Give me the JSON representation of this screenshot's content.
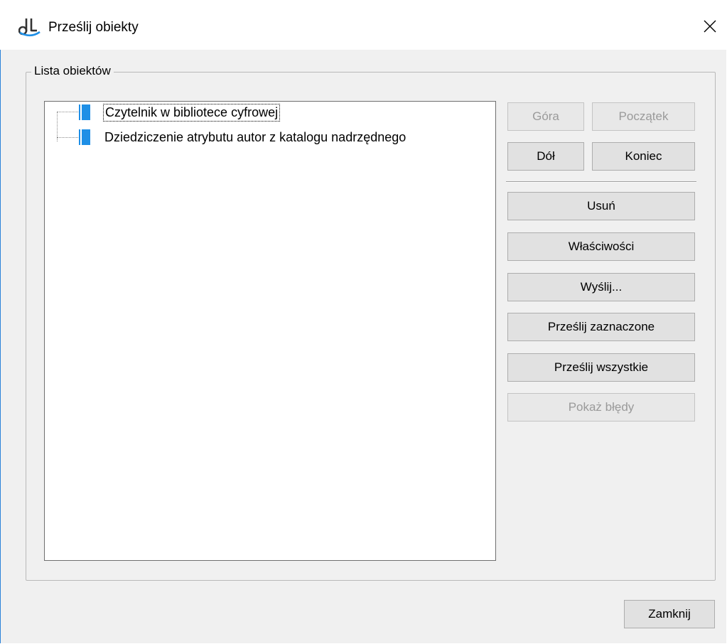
{
  "window": {
    "title": "Prześlij obiekty",
    "close_symbol": "✕"
  },
  "group": {
    "legend": "Lista obiektów"
  },
  "tree": {
    "items": [
      {
        "label": "Czytelnik w bibliotece cyfrowej",
        "icon": "document-icon",
        "selected": true
      },
      {
        "label": "Dziedziczenie atrybutu autor z katalogu nadrzędnego",
        "icon": "document-icon",
        "selected": false
      }
    ]
  },
  "buttons": {
    "gora": "Góra",
    "poczatek": "Początek",
    "dol": "Dół",
    "koniec": "Koniec",
    "usun": "Usuń",
    "wlasciwosci": "Właściwości",
    "wyslij": "Wyślij...",
    "przeslij_zaznaczone": "Prześlij zaznaczone",
    "przeslij_wszystkie": "Prześlij wszystkie",
    "pokaz_bledy": "Pokaż błędy",
    "zamknij": "Zamknij"
  },
  "colors": {
    "accent": "#1e8fe6",
    "window_border": "#2b83d9",
    "dialog_bg": "#f0f0f0",
    "button_bg": "#e1e1e1",
    "disabled_text": "#9a9a9a"
  }
}
